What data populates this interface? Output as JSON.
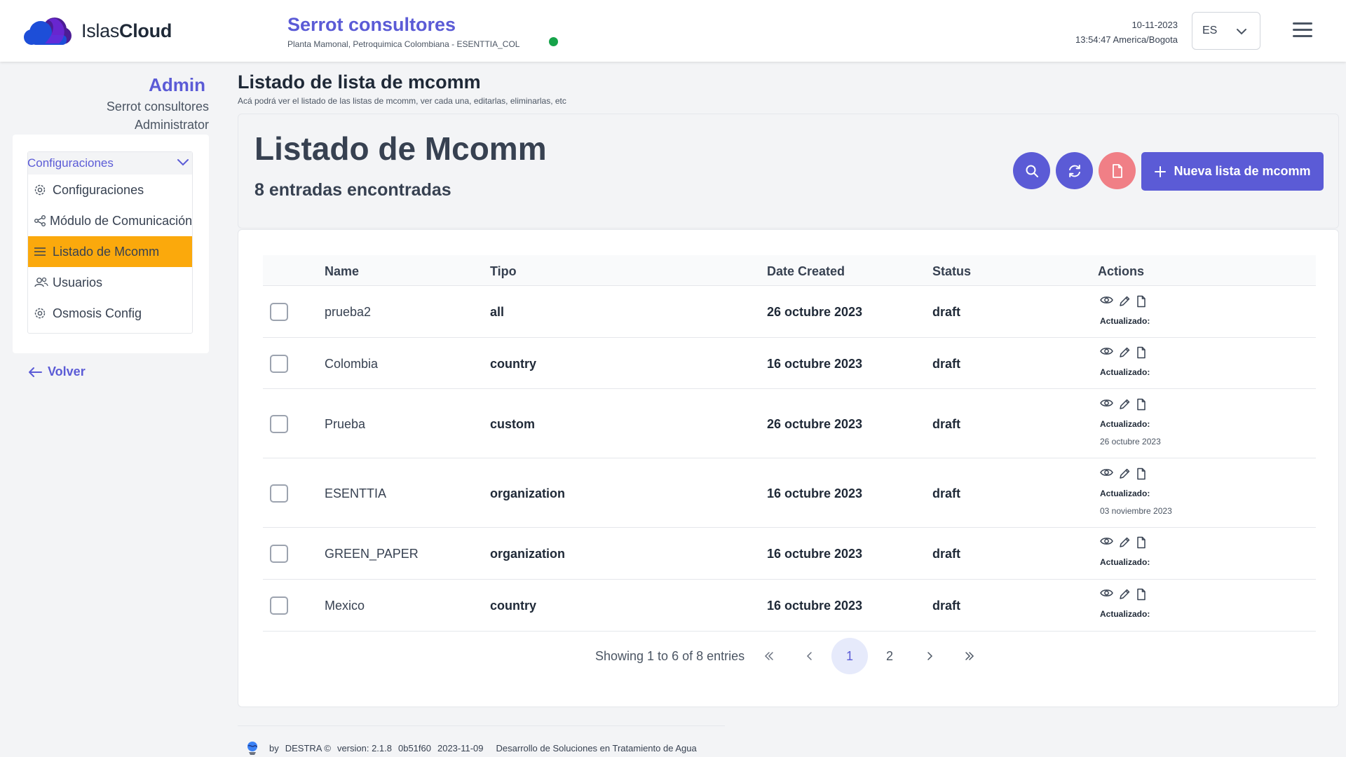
{
  "header": {
    "brand_light": "Islas",
    "brand_bold": "Cloud",
    "org_name": "Serrot consultores",
    "org_location": "Planta Mamonal, Petroquimica Colombiana - ESENTTIA_COL",
    "status_color": "#16a34a",
    "date": "10-11-2023",
    "time": "13:54:47 America/Bogota",
    "language": "ES"
  },
  "sidebar": {
    "user_title": "Admin",
    "user_org": "Serrot consultores",
    "user_role": "Administrator",
    "section_label": "Configuraciones",
    "items": [
      {
        "label": "Configuraciones",
        "icon": "gear-icon"
      },
      {
        "label": "Módulo de Comunicación",
        "icon": "share-icon"
      },
      {
        "label": "Listado de Mcomm",
        "icon": "list-icon"
      },
      {
        "label": "Usuarios",
        "icon": "users-icon"
      },
      {
        "label": "Osmosis Config",
        "icon": "gear-icon"
      }
    ],
    "back_label": "Volver"
  },
  "page": {
    "title": "Listado de lista de mcomm",
    "description": "Acá podrá ver el listado de las listas de mcomm, ver cada una, editarlas, eliminarlas, etc"
  },
  "summary": {
    "title": "Listado de Mcomm",
    "count_text": "8 entradas encontradas",
    "new_button": "Nueva lista de mcomm"
  },
  "table": {
    "headers": [
      "Name",
      "Tipo",
      "Date Created",
      "Status",
      "Actions"
    ],
    "updated_label": "Actualizado:",
    "rows": [
      {
        "name": "prueba2",
        "tipo": "all",
        "date": "26 octubre 2023",
        "status": "draft",
        "updated": ""
      },
      {
        "name": "Colombia",
        "tipo": "country",
        "date": "16 octubre 2023",
        "status": "draft",
        "updated": ""
      },
      {
        "name": "Prueba",
        "tipo": "custom",
        "date": "26 octubre 2023",
        "status": "draft",
        "updated": "26 octubre 2023"
      },
      {
        "name": "ESENTTIA",
        "tipo": "organization",
        "date": "16 octubre 2023",
        "status": "draft",
        "updated": "03 noviembre 2023"
      },
      {
        "name": "GREEN_PAPER",
        "tipo": "organization",
        "date": "16 octubre 2023",
        "status": "draft",
        "updated": ""
      },
      {
        "name": "Mexico",
        "tipo": "country",
        "date": "16 octubre 2023",
        "status": "draft",
        "updated": ""
      }
    ]
  },
  "pagination": {
    "info": "Showing 1 to 6 of 8 entries",
    "pages": [
      "1",
      "2"
    ],
    "current_page": "1"
  },
  "footer": {
    "by": "by",
    "company": "DESTRA ©",
    "version": "version: 2.1.8",
    "commit": "0b51f60",
    "build_date": "2023-11-09",
    "tagline": "Desarrollo de Soluciones en Tratamiento de Agua"
  },
  "colors": {
    "accent": "#5b5bd6",
    "active_nav": "#fba90c",
    "export_button": "#f07f86"
  }
}
